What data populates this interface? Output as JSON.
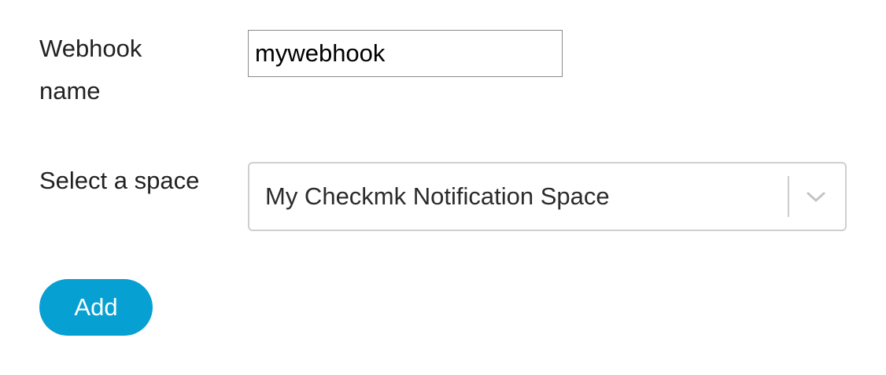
{
  "form": {
    "webhook_name_label": "Webhook name",
    "webhook_name_value": "mywebhook",
    "space_label": "Select a space",
    "space_selected": "My Checkmk Notification Space",
    "space_dropdown_icon": "chevron-down-icon",
    "add_button_label": "Add"
  },
  "colors": {
    "accent": "#07a0d2",
    "text": "#222222",
    "border": "#cfcfcf"
  }
}
